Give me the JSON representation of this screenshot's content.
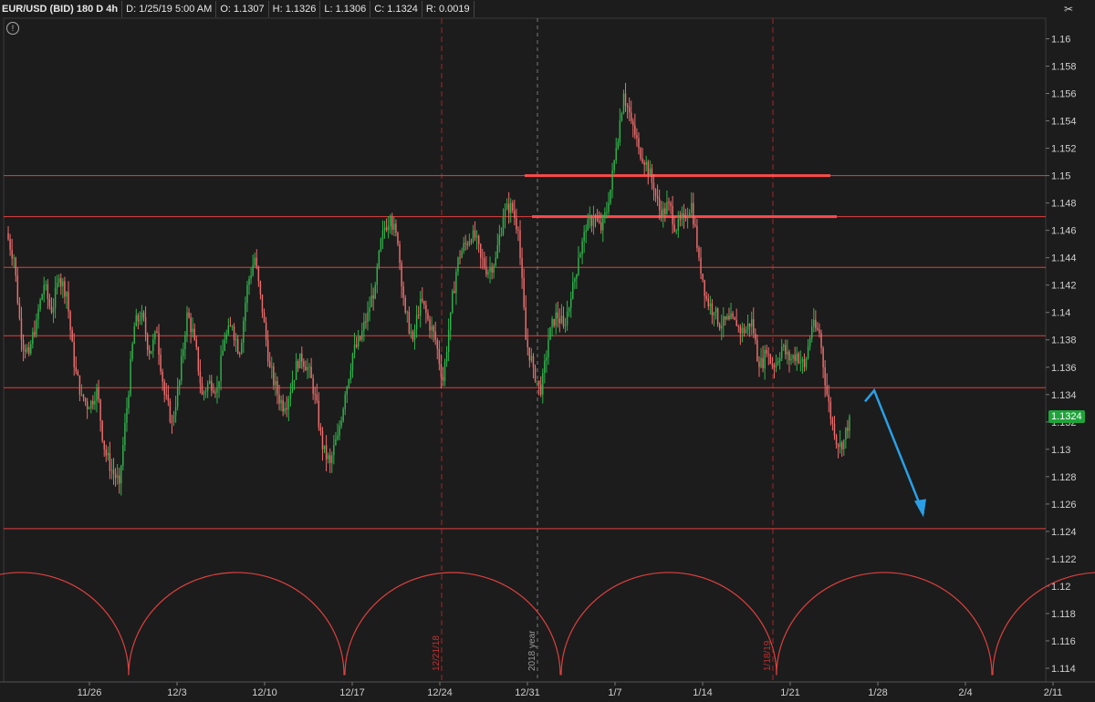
{
  "header": {
    "symbol": "EUR/USD (BID) 180 D 4h",
    "date": "D: 1/25/19 5:00 AM",
    "open": "O: 1.1307",
    "high": "H: 1.1326",
    "low": "L: 1.1306",
    "close": "C: 1.1324",
    "range": "R: 0.0019"
  },
  "icons": {
    "settings": "settings-icon",
    "draw_tool": "draw-tool-icon"
  },
  "colors": {
    "background": "#1c1c1c",
    "up": "#2fb34a",
    "down": "#ef6c6c",
    "levels": "#e0403f",
    "arrow": "#2a9fe6",
    "badge": "#1fa33a"
  },
  "last_price_label": "1.1324",
  "chart_data": {
    "type": "candlestick",
    "ylim": [
      1.113,
      1.1615
    ],
    "y_ticks": [
      1.114,
      1.116,
      1.118,
      1.12,
      1.122,
      1.124,
      1.126,
      1.128,
      1.13,
      1.132,
      1.134,
      1.136,
      1.138,
      1.14,
      1.142,
      1.144,
      1.146,
      1.148,
      1.15,
      1.152,
      1.154,
      1.156,
      1.158,
      1.16
    ],
    "x_ticks": [
      "11/26",
      "12/3",
      "12/10",
      "12/17",
      "12/24",
      "12/31",
      "1/7",
      "1/14",
      "1/21",
      "1/28",
      "2/4",
      "2/11"
    ],
    "horizontal_levels": [
      1.15,
      1.147,
      1.1433,
      1.1383,
      1.1345,
      1.1242
    ],
    "short_levels": [
      {
        "y": 1.15,
        "from": "12/31",
        "to": "1/21"
      },
      {
        "y": 1.147,
        "from": "12/31",
        "to": "1/21"
      }
    ],
    "vertical_markers": [
      {
        "x": "12/21/18",
        "label": "12/21/18"
      },
      {
        "x": "2018 year",
        "label": "2018 year"
      },
      {
        "x": "1/18/19",
        "label": "1/18/19"
      }
    ],
    "price_path": [
      1.1458,
      1.144,
      1.138,
      1.137,
      1.1395,
      1.142,
      1.14,
      1.1425,
      1.1415,
      1.136,
      1.134,
      1.133,
      1.1345,
      1.13,
      1.1285,
      1.1275,
      1.133,
      1.139,
      1.14,
      1.137,
      1.1385,
      1.134,
      1.132,
      1.135,
      1.14,
      1.138,
      1.134,
      1.135,
      1.1345,
      1.138,
      1.139,
      1.137,
      1.142,
      1.144,
      1.14,
      1.136,
      1.134,
      1.133,
      1.135,
      1.137,
      1.136,
      1.134,
      1.13,
      1.129,
      1.131,
      1.134,
      1.137,
      1.138,
      1.14,
      1.142,
      1.146,
      1.147,
      1.145,
      1.14,
      1.138,
      1.141,
      1.1395,
      1.138,
      1.135,
      1.14,
      1.144,
      1.145,
      1.146,
      1.144,
      1.143,
      1.144,
      1.147,
      1.148,
      1.146,
      1.138,
      1.136,
      1.134,
      1.138,
      1.14,
      1.139,
      1.141,
      1.144,
      1.146,
      1.147,
      1.146,
      1.148,
      1.152,
      1.156,
      1.154,
      1.152,
      1.151,
      1.149,
      1.147,
      1.148,
      1.146,
      1.147,
      1.148,
      1.144,
      1.141,
      1.14,
      1.139,
      1.1395,
      1.139,
      1.1385,
      1.1395,
      1.136,
      1.137,
      1.136,
      1.1375,
      1.1365,
      1.137,
      1.136,
      1.139,
      1.1385,
      1.134,
      1.131,
      1.13,
      1.1324
    ],
    "projection": {
      "from": {
        "x": "1/21+",
        "y": 1.1335
      },
      "peak": {
        "x": "1/28-",
        "y": 1.1343
      },
      "to": {
        "x": "2/4-",
        "y": 1.1253
      }
    }
  }
}
